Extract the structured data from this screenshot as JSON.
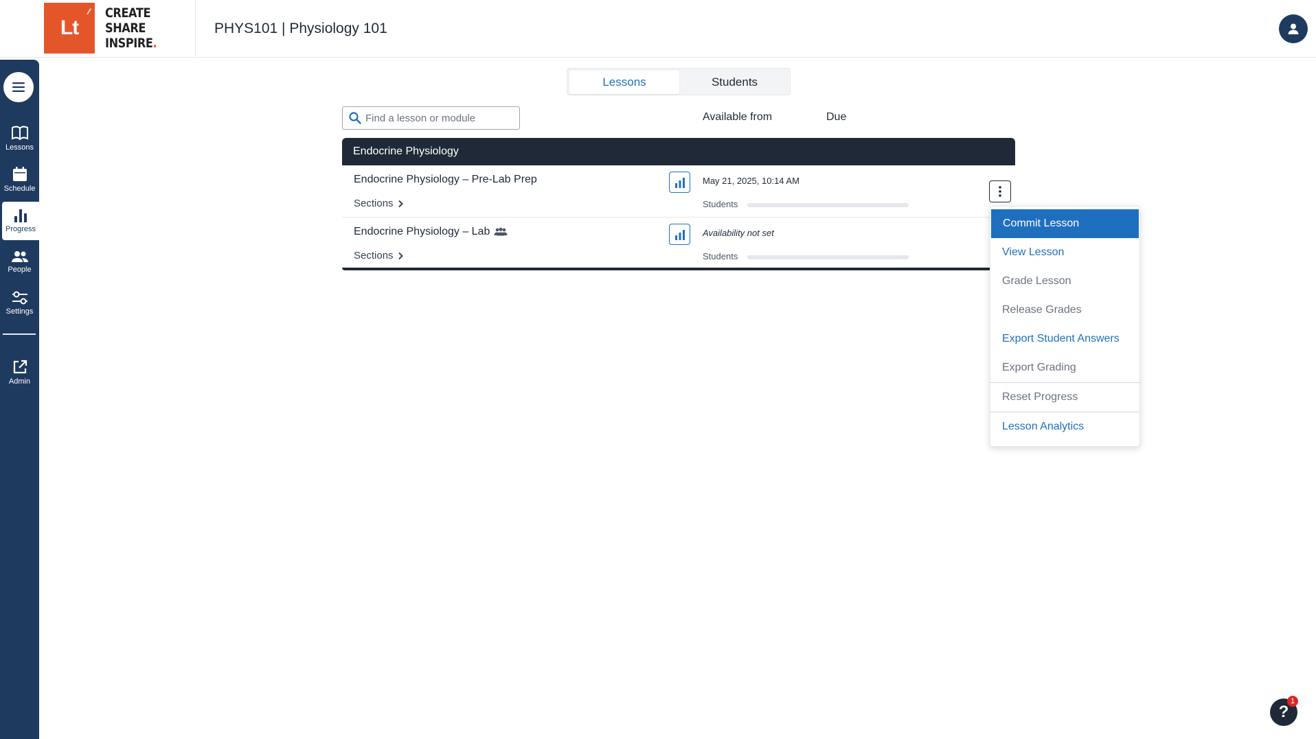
{
  "brand": {
    "logo_text": "Lt",
    "tagline": [
      "CREATE",
      "SHARE",
      "INSPIRE"
    ],
    "accent_color": "#e4562a"
  },
  "header": {
    "course_title": "PHYS101 | Physiology 101"
  },
  "sidebar": {
    "items": [
      {
        "label": "Lessons",
        "icon": "book-icon"
      },
      {
        "label": "Schedule",
        "icon": "calendar-icon"
      },
      {
        "label": "Progress",
        "icon": "bar-chart-icon"
      },
      {
        "label": "People",
        "icon": "people-icon"
      },
      {
        "label": "Settings",
        "icon": "sliders-icon"
      },
      {
        "label": "Admin",
        "icon": "external-link-icon"
      }
    ],
    "active": "Progress",
    "color": "#1f3a5f"
  },
  "tabs": [
    {
      "label": "Lessons",
      "selected": true
    },
    {
      "label": "Students",
      "selected": false
    }
  ],
  "search": {
    "placeholder": "Find a lesson or module",
    "value": ""
  },
  "columns": {
    "available_from": "Available from",
    "due": "Due"
  },
  "module": {
    "title": "Endocrine Physiology",
    "lessons": [
      {
        "title": "Endocrine Physiology – Pre-Lab Prep",
        "sections_label": "Sections",
        "availability": "May 21, 2025, 10:14 AM",
        "students_label": "Students",
        "progress": 0,
        "group_icon": false
      },
      {
        "title": "Endocrine Physiology – Lab",
        "sections_label": "Sections",
        "availability": "Availability not set",
        "students_label": "Students",
        "progress": 0,
        "group_icon": true
      }
    ]
  },
  "lesson_menu": {
    "items": [
      {
        "label": "Commit Lesson",
        "state": "active"
      },
      {
        "label": "View Lesson",
        "state": "enabled"
      },
      {
        "label": "Grade Lesson",
        "state": "disabled"
      },
      {
        "label": "Release Grades",
        "state": "disabled"
      },
      {
        "label": "Export Student Answers",
        "state": "enabled"
      },
      {
        "label": "Export Grading",
        "state": "disabled"
      },
      {
        "label": "Reset Progress",
        "state": "disabled"
      },
      {
        "label": "Lesson Analytics",
        "state": "enabled"
      }
    ],
    "accent_color": "#1f6fbf"
  },
  "help": {
    "label": "?",
    "badge_count": "1"
  }
}
